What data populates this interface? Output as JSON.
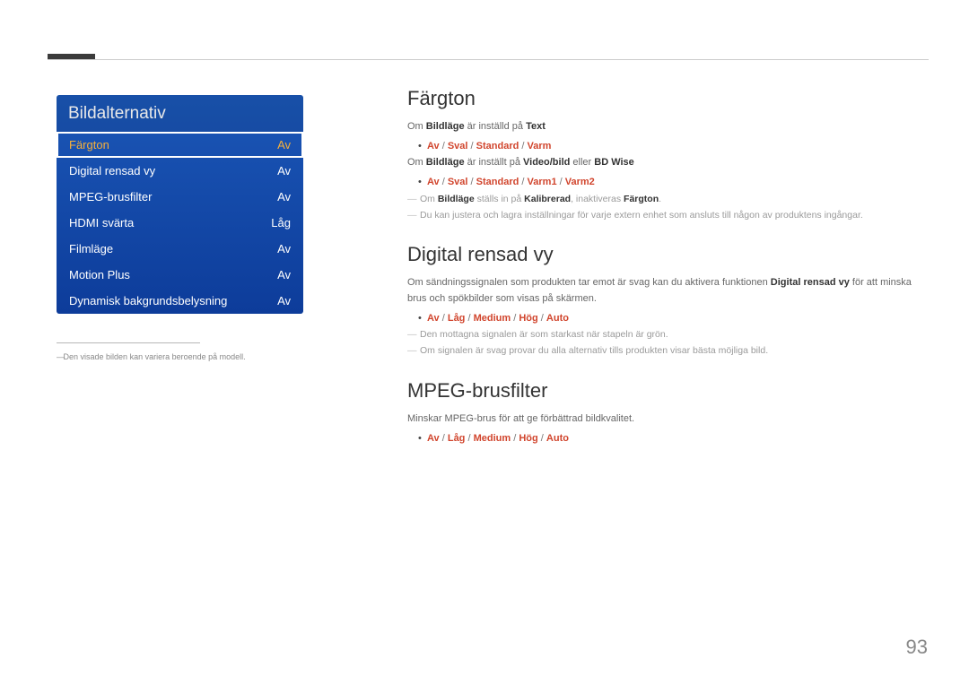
{
  "page_number": "93",
  "menu": {
    "title": "Bildalternativ",
    "items": [
      {
        "label": "Färgton",
        "value": "Av",
        "selected": true
      },
      {
        "label": "Digital rensad vy",
        "value": "Av"
      },
      {
        "label": "MPEG-brusfilter",
        "value": "Av"
      },
      {
        "label": "HDMI svärta",
        "value": "Låg"
      },
      {
        "label": "Filmläge",
        "value": "Av"
      },
      {
        "label": "Motion Plus",
        "value": "Av"
      },
      {
        "label": "Dynamisk bakgrundsbelysning",
        "value": "Av"
      }
    ]
  },
  "side_footnote": "Den visade bilden kan variera beroende på modell.",
  "sections": {
    "fargton": {
      "heading": "Färgton",
      "l1_pre": "Om ",
      "l1_b": "Bildläge",
      "l1_mid": " är inställd på ",
      "l1_b2": "Text",
      "opts1": {
        "a": "Av",
        "b": "Sval",
        "c": "Standard",
        "d": "Varm"
      },
      "l2_pre": "Om ",
      "l2_b": "Bildläge",
      "l2_mid": " är inställt på ",
      "l2_b2": "Video/bild",
      "l2_mid2": " eller ",
      "l2_b3": "BD Wise",
      "opts2": {
        "a": "Av",
        "b": "Sval",
        "c": "Standard",
        "d": "Varm1",
        "e": "Varm2"
      },
      "note1_pre": "Om ",
      "note1_b": "Bildläge",
      "note1_mid": " ställs in på ",
      "note1_b2": "Kalibrerad",
      "note1_mid2": ", inaktiveras ",
      "note1_b3": "Färgton",
      "note1_end": ".",
      "note2": "Du kan justera och lagra inställningar för varje extern enhet som ansluts till någon av produktens ingångar."
    },
    "digital": {
      "heading": "Digital rensad vy",
      "p_pre": "Om sändningssignalen som produkten tar emot är svag kan du aktivera funktionen ",
      "p_b": "Digital rensad vy",
      "p_post": " för att minska brus och spökbilder som visas på skärmen.",
      "opts": {
        "a": "Av",
        "b": "Låg",
        "c": "Medium",
        "d": "Hög",
        "e": "Auto"
      },
      "note1": "Den mottagna signalen är som starkast när stapeln är grön.",
      "note2": "Om signalen är svag provar du alla alternativ tills produkten visar bästa möjliga bild."
    },
    "mpeg": {
      "heading": "MPEG-brusfilter",
      "p": "Minskar MPEG-brus för att ge förbättrad bildkvalitet.",
      "opts": {
        "a": "Av",
        "b": "Låg",
        "c": "Medium",
        "d": "Hög",
        "e": "Auto"
      }
    }
  }
}
